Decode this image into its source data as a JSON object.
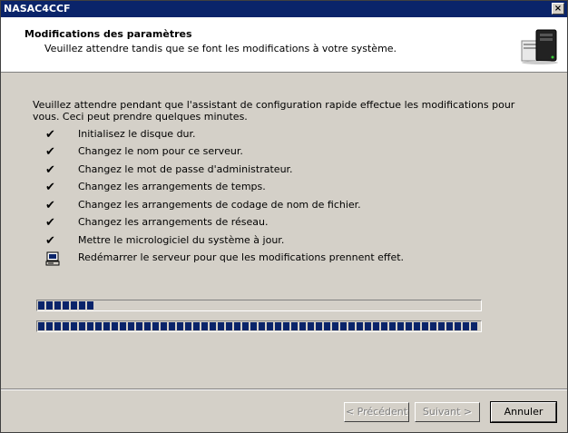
{
  "window": {
    "title": "NASAC4CCF",
    "close_glyph": "×"
  },
  "header": {
    "title": "Modifications des paramètres",
    "subtitle": "Veuillez attendre tandis que se font les modifications à votre système.",
    "icon": "server-computer-icon"
  },
  "body": {
    "intro": "Veuillez attendre pendant que l'assistant de configuration rapide effectue les modifications pour vous.  Ceci peut prendre quelques minutes.",
    "steps": [
      {
        "label": "Initialisez le disque dur.",
        "status": "done",
        "mark": "✔"
      },
      {
        "label": "Changez le nom pour ce serveur.",
        "status": "done",
        "mark": "✔"
      },
      {
        "label": "Changez le mot de passe d'administrateur.",
        "status": "done",
        "mark": "✔"
      },
      {
        "label": "Changez les arrangements de temps.",
        "status": "done",
        "mark": "✔"
      },
      {
        "label": "Changez les arrangements de codage de nom de fichier.",
        "status": "done",
        "mark": "✔"
      },
      {
        "label": "Changez les arrangements de réseau.",
        "status": "done",
        "mark": "✔"
      },
      {
        "label": "Mettre le micrologiciel du système à jour.",
        "status": "done",
        "mark": "✔"
      },
      {
        "label": "Redémarrer le serveur pour que les modifications prennent effet.",
        "status": "in-progress",
        "mark": "computer-icon"
      }
    ],
    "progress_current": 0.13,
    "progress_overall": 1.0
  },
  "buttons": {
    "back": "< Précédent",
    "next": "Suivant >",
    "cancel": "Annuler"
  }
}
